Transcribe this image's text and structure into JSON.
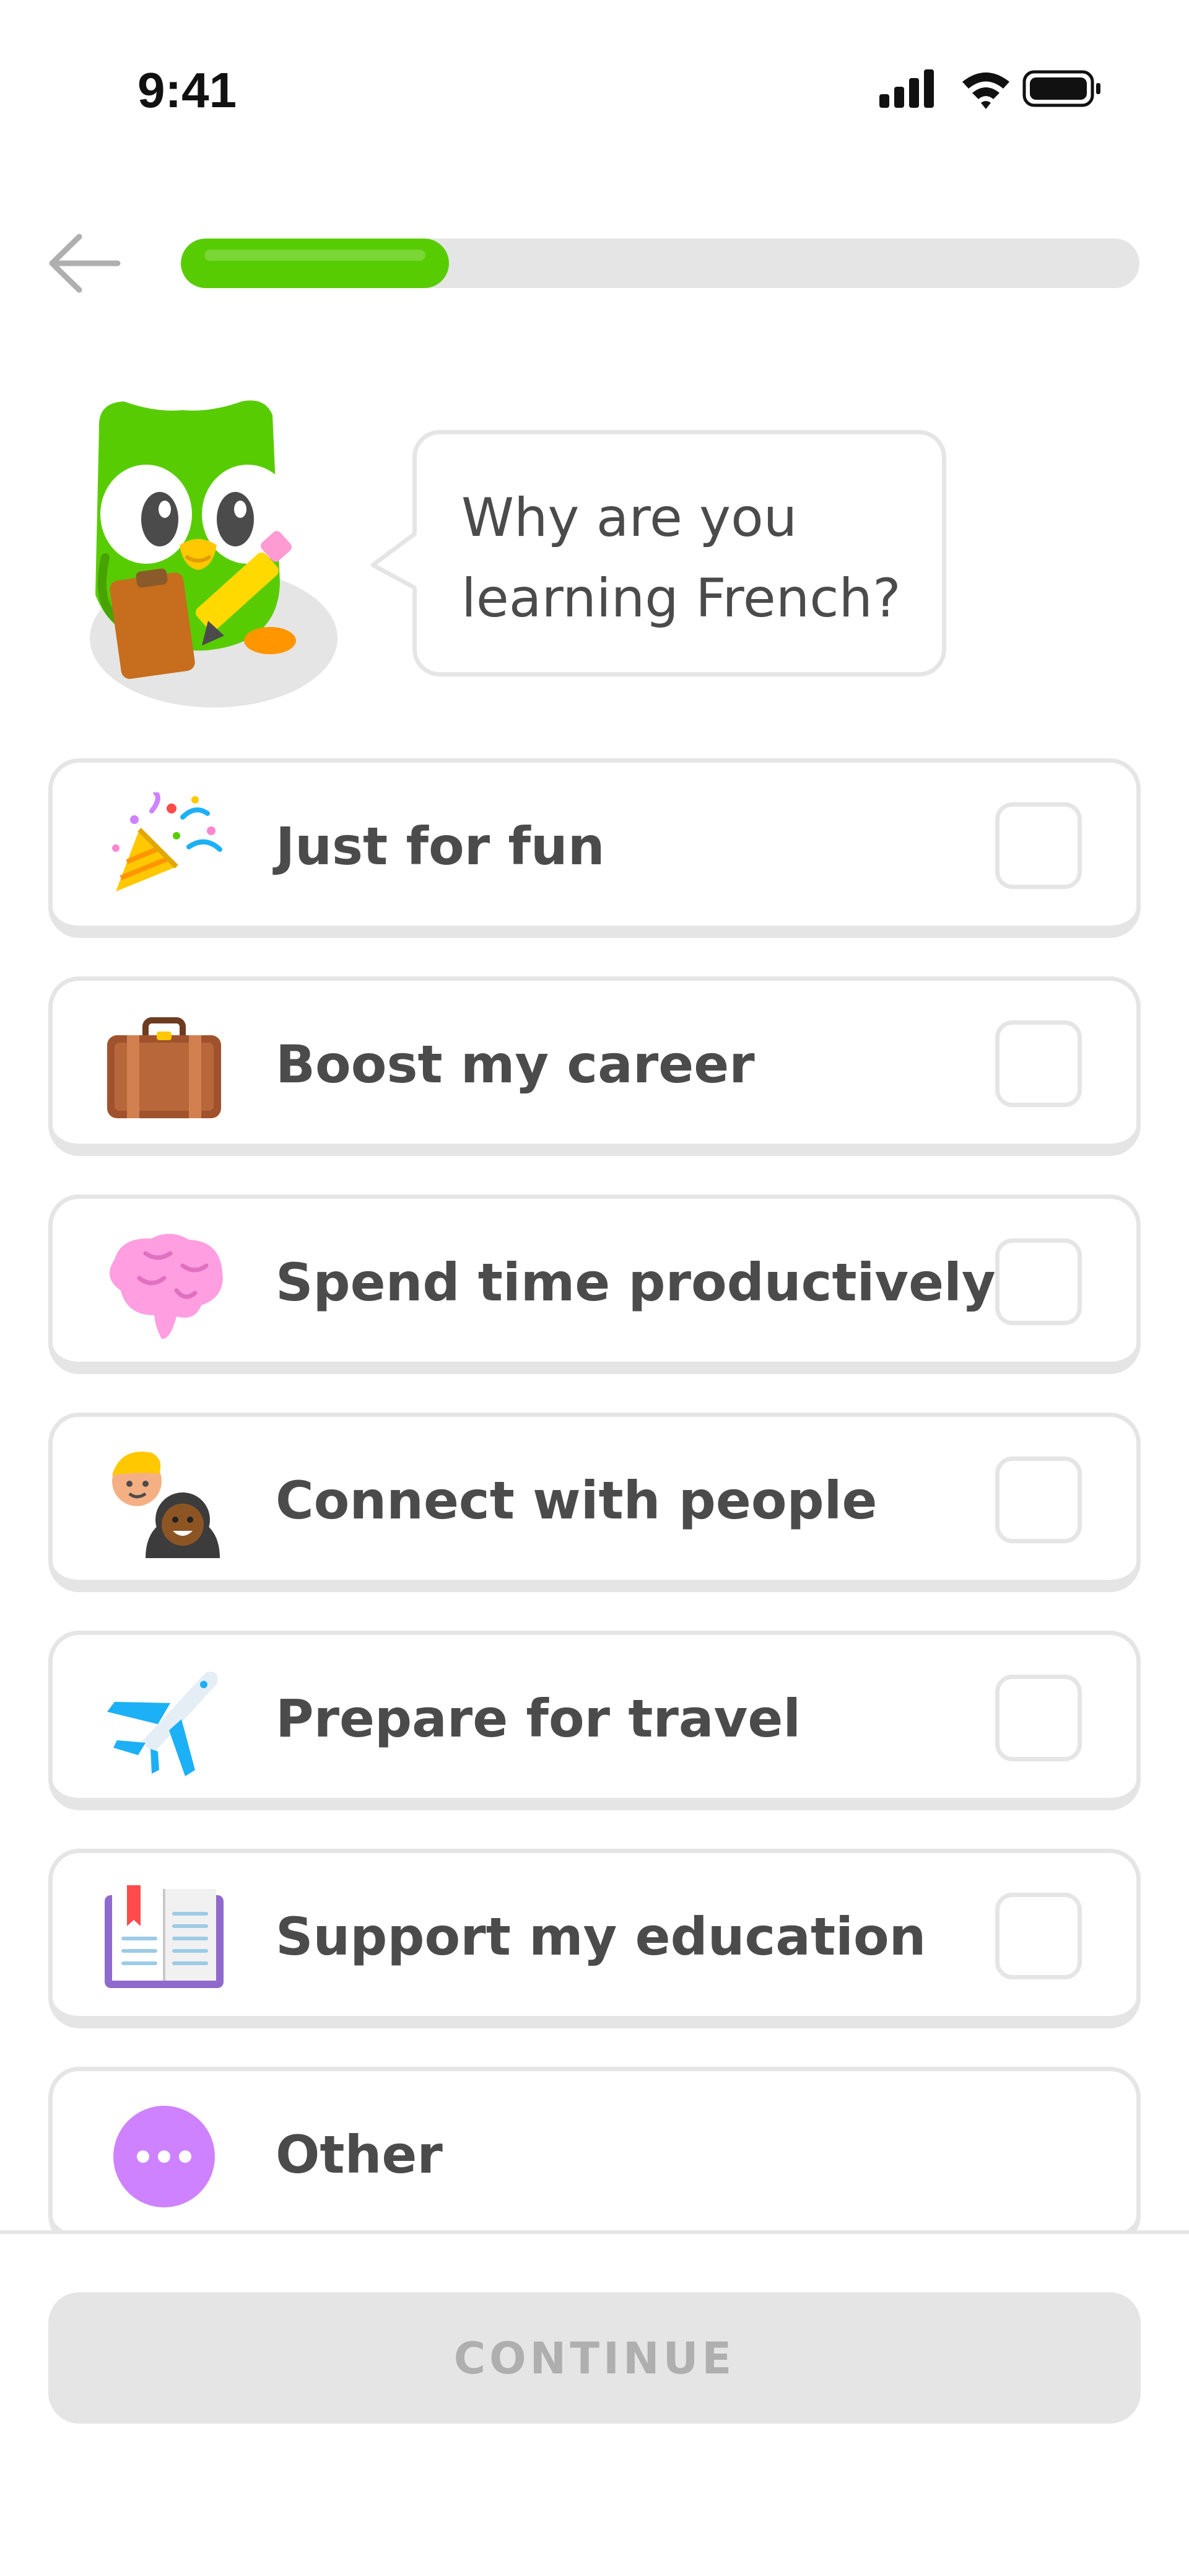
{
  "status_bar": {
    "time": "9:41",
    "icons": [
      "signal-icon",
      "wifi-icon",
      "battery-icon"
    ]
  },
  "header": {
    "back_icon": "arrow-left-icon",
    "progress": 0.28,
    "colors": {
      "progress_fill": "#58cc02",
      "track": "#e5e5e5"
    }
  },
  "prompt": {
    "mascot": "owl-mascot-with-clipboard",
    "lines": [
      "Why are you",
      "learning French?"
    ]
  },
  "options": [
    {
      "icon": "party-popper-icon",
      "label": "Just for fun",
      "has_checkbox": true
    },
    {
      "icon": "briefcase-icon",
      "label": "Boost my career",
      "has_checkbox": true
    },
    {
      "icon": "brain-icon",
      "label": "Spend time productively",
      "has_checkbox": true
    },
    {
      "icon": "people-icon",
      "label": "Connect with people",
      "has_checkbox": true
    },
    {
      "icon": "airplane-icon",
      "label": "Prepare for travel",
      "has_checkbox": true
    },
    {
      "icon": "book-icon",
      "label": "Support my education",
      "has_checkbox": true
    },
    {
      "icon": "more-dots-icon",
      "label": "Other",
      "has_checkbox": false
    }
  ],
  "footer": {
    "continue_label": "CONTINUE",
    "continue_enabled": false
  },
  "colors": {
    "accent_green": "#58cc02",
    "border_gray": "#e5e5e5",
    "text_dark": "#4b4b4b",
    "disabled_text": "#afafaf"
  }
}
